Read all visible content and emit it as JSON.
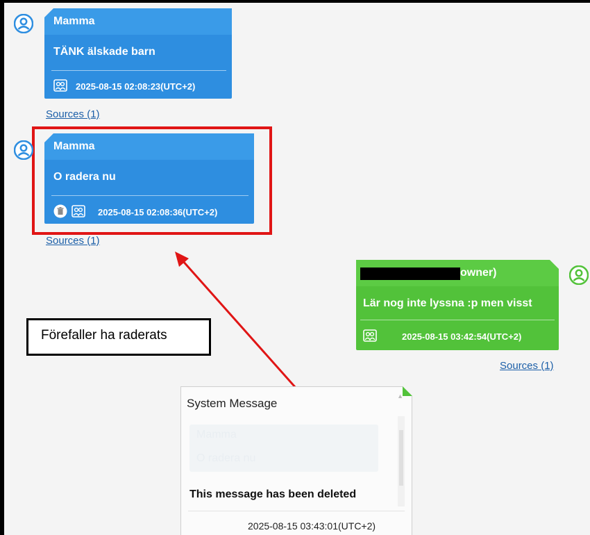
{
  "messages": [
    {
      "sender": "Mamma",
      "text": "TÄNK älskade barn",
      "timestamp": "2025-08-15 02:08:23(UTC+2)",
      "sources": "Sources (1)",
      "deleted_icon": false
    },
    {
      "sender": "Mamma",
      "text": "O radera nu",
      "timestamp": "2025-08-15 02:08:36(UTC+2)",
      "sources": "Sources (1)",
      "deleted_icon": true
    },
    {
      "sender": "owner)",
      "text": "Lär nog inte lyssna :p men visst",
      "timestamp": "2025-08-15 03:42:54(UTC+2)",
      "sources": "Sources (1)"
    }
  ],
  "annotation": {
    "callout": "Förefaller ha raderats"
  },
  "system_message": {
    "title": "System Message",
    "quoted_sender": "Mamma",
    "quoted_text": "O radera nu",
    "body": "This message has been deleted",
    "timestamp": "2025-08-15 03:43:01(UTC+2)"
  },
  "colors": {
    "incoming": "#2e8ee0",
    "outgoing": "#52c23a",
    "highlight": "#e01515",
    "link": "#1c5fa8"
  },
  "icons": {
    "avatar": "user-avatar-icon",
    "contacts": "contacts-icon",
    "trash": "trash-icon"
  }
}
